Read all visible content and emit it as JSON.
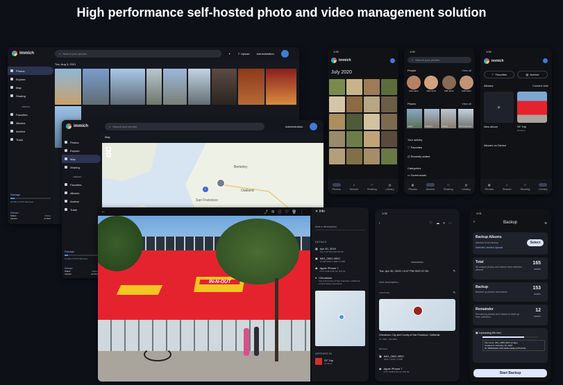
{
  "headline": "High performance self-hosted photo and video management solution",
  "desktop1": {
    "brand": "immich",
    "search_placeholder": "Search your photos",
    "upload": "Upload",
    "admin": "Administration",
    "date_header": "Tue, Aug 3, 2021",
    "sidebar": [
      "Photos",
      "Explore",
      "Map",
      "Sharing"
    ],
    "library_header": "LIBRARY",
    "library": [
      "Favorites",
      "Albums",
      "Archive",
      "Trash"
    ],
    "storage_title": "Storage",
    "storage_value": "12 GB of 473.5 GB used",
    "server_title": "Server",
    "server_rows": [
      [
        "Status",
        "Online"
      ],
      [
        "Version",
        "v1.94.0"
      ]
    ]
  },
  "desktop2": {
    "brand": "immich",
    "search_placeholder": "Search your photos",
    "admin": "Administration",
    "map_label": "Map",
    "sidebar": [
      "Photos",
      "Explore",
      "Map",
      "Sharing"
    ],
    "library_header": "LIBRARY",
    "library": [
      "Favorites",
      "Albums",
      "Archive",
      "Trash"
    ],
    "map_places": [
      "Berkeley",
      "Oakland",
      "San Francisco"
    ],
    "cluster_count": "7",
    "storage_title": "Storage",
    "storage_value": "12 GB of 473.5 GB used",
    "server_title": "Server",
    "server_rows": [
      [
        "Status",
        "Online"
      ],
      [
        "Version",
        "v1.94.0"
      ]
    ]
  },
  "viewer": {
    "info_title": "Info",
    "add_description": "Add a description",
    "details_header": "DETAILS",
    "date": "Apr 30, 2019",
    "date_sub": "Tue, 6:07 PM GMT-07:00",
    "file": "IMG_2841.HEIC",
    "file_sub": "12 MP  3024 x 4032  1.6 MB",
    "camera": "Apple iPhone 7",
    "camera_sub": "f/1.8  1/138  3.99 mm  ISO 20",
    "location": "Chinatown",
    "location_sub": "City and County of San Francisco, California, United States of America",
    "appears_in": "APPEARS IN",
    "album_name": "SF Trip",
    "album_sub": "16 items",
    "sign_text": "IN-N-OUT"
  },
  "phone_timeline": {
    "time": "1:00",
    "brand": "immich",
    "month": "July 2020",
    "nav": [
      "Photos",
      "Search",
      "Sharing",
      "Library"
    ]
  },
  "phone_search": {
    "time": "1:00",
    "search_placeholder": "Search your photos",
    "people_title": "People",
    "view_all": "View all",
    "people": [
      "Add name",
      "Add name",
      "Add name",
      "Add name"
    ],
    "places_title": "Places",
    "places": [
      "Apple",
      "Oakland",
      "Vallejo",
      "San Francisco"
    ],
    "your_activity": "Your activity",
    "activity": [
      "Favorites",
      "Recently added"
    ],
    "categories": "Categories",
    "category_items": [
      "Screenshots"
    ],
    "nav": [
      "Photos",
      "Search",
      "Sharing",
      "Library"
    ]
  },
  "phone_library": {
    "time": "1:00",
    "brand": "immich",
    "favorites": "Favorites",
    "archive": "Archive",
    "albums_title": "Albums",
    "sort_label": "Created date",
    "new_album": "New album",
    "album_name": "SF Trip",
    "album_count": "16 items",
    "on_device": "Albums on Device",
    "nav": [
      "Photos",
      "Search",
      "Sharing",
      "Library"
    ]
  },
  "phone_detail": {
    "time": "1:02",
    "date": "Tue, Apr 30, 2019 • 6:07 PM GMT-07:00",
    "add_description": "Add description...",
    "location_header": "LOCATION",
    "location": "Chinatown, City and County of San Francisco, California",
    "coords": "37.7949, -122.4064",
    "details_header": "DETAILS",
    "file": "IMG_2841.HEIC",
    "file_sub": "3024 x 4032  1.6 MB",
    "camera": "Apple iPhone 7",
    "camera_sub": "f/1.8  1/138  3.99 mm  ISO 20"
  },
  "phone_backup": {
    "time": "1:01",
    "title": "Backup",
    "backup_albums": "Backup Albums",
    "albums_to_backup": "Albums to be backup",
    "selected": "Selected: Immich Upload",
    "select": "Select",
    "stats": [
      {
        "label": "Total",
        "desc": "All unique photos and videos from selected albums",
        "value": "165",
        "unit": "assets"
      },
      {
        "label": "Backup",
        "desc": "Backed up photos and videos",
        "value": "153",
        "unit": "assets"
      },
      {
        "label": "Remainder",
        "desc": "Remaining photos and videos to back up from selection",
        "value": "12",
        "unit": "assets"
      }
    ],
    "uploading": "Uploading file info",
    "upload_percent": 75,
    "upload_lines": [
      "File name: IMG_2845.HEIC (image)",
      "Created at: February 15, 2019",
      "ID: 5B96D9A8-1049-400E-AE4E-22754C5B..."
    ],
    "start": "Start Backup"
  },
  "colors": {
    "background": "#0d1017",
    "accent": "#4f8bf5",
    "pill": "#dfe6ff",
    "sign_red": "#e5232e",
    "sign_yellow": "#f3c623"
  }
}
